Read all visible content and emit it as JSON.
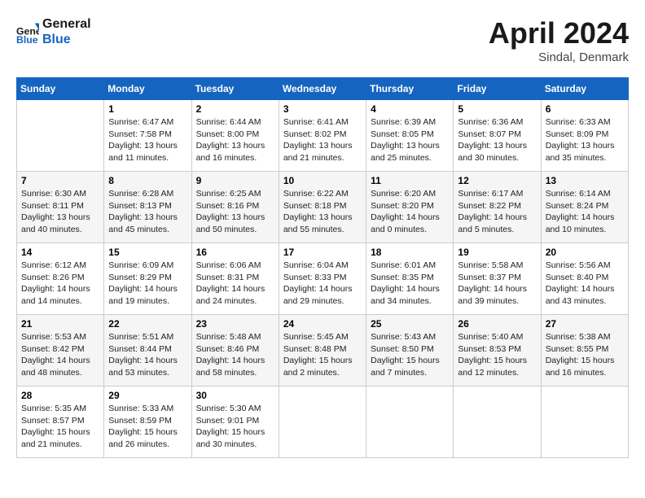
{
  "header": {
    "logo_line1": "General",
    "logo_line2": "Blue",
    "month": "April 2024",
    "location": "Sindal, Denmark"
  },
  "weekdays": [
    "Sunday",
    "Monday",
    "Tuesday",
    "Wednesday",
    "Thursday",
    "Friday",
    "Saturday"
  ],
  "weeks": [
    [
      {
        "day": "",
        "sunrise": "",
        "sunset": "",
        "daylight": ""
      },
      {
        "day": "1",
        "sunrise": "Sunrise: 6:47 AM",
        "sunset": "Sunset: 7:58 PM",
        "daylight": "Daylight: 13 hours and 11 minutes."
      },
      {
        "day": "2",
        "sunrise": "Sunrise: 6:44 AM",
        "sunset": "Sunset: 8:00 PM",
        "daylight": "Daylight: 13 hours and 16 minutes."
      },
      {
        "day": "3",
        "sunrise": "Sunrise: 6:41 AM",
        "sunset": "Sunset: 8:02 PM",
        "daylight": "Daylight: 13 hours and 21 minutes."
      },
      {
        "day": "4",
        "sunrise": "Sunrise: 6:39 AM",
        "sunset": "Sunset: 8:05 PM",
        "daylight": "Daylight: 13 hours and 25 minutes."
      },
      {
        "day": "5",
        "sunrise": "Sunrise: 6:36 AM",
        "sunset": "Sunset: 8:07 PM",
        "daylight": "Daylight: 13 hours and 30 minutes."
      },
      {
        "day": "6",
        "sunrise": "Sunrise: 6:33 AM",
        "sunset": "Sunset: 8:09 PM",
        "daylight": "Daylight: 13 hours and 35 minutes."
      }
    ],
    [
      {
        "day": "7",
        "sunrise": "Sunrise: 6:30 AM",
        "sunset": "Sunset: 8:11 PM",
        "daylight": "Daylight: 13 hours and 40 minutes."
      },
      {
        "day": "8",
        "sunrise": "Sunrise: 6:28 AM",
        "sunset": "Sunset: 8:13 PM",
        "daylight": "Daylight: 13 hours and 45 minutes."
      },
      {
        "day": "9",
        "sunrise": "Sunrise: 6:25 AM",
        "sunset": "Sunset: 8:16 PM",
        "daylight": "Daylight: 13 hours and 50 minutes."
      },
      {
        "day": "10",
        "sunrise": "Sunrise: 6:22 AM",
        "sunset": "Sunset: 8:18 PM",
        "daylight": "Daylight: 13 hours and 55 minutes."
      },
      {
        "day": "11",
        "sunrise": "Sunrise: 6:20 AM",
        "sunset": "Sunset: 8:20 PM",
        "daylight": "Daylight: 14 hours and 0 minutes."
      },
      {
        "day": "12",
        "sunrise": "Sunrise: 6:17 AM",
        "sunset": "Sunset: 8:22 PM",
        "daylight": "Daylight: 14 hours and 5 minutes."
      },
      {
        "day": "13",
        "sunrise": "Sunrise: 6:14 AM",
        "sunset": "Sunset: 8:24 PM",
        "daylight": "Daylight: 14 hours and 10 minutes."
      }
    ],
    [
      {
        "day": "14",
        "sunrise": "Sunrise: 6:12 AM",
        "sunset": "Sunset: 8:26 PM",
        "daylight": "Daylight: 14 hours and 14 minutes."
      },
      {
        "day": "15",
        "sunrise": "Sunrise: 6:09 AM",
        "sunset": "Sunset: 8:29 PM",
        "daylight": "Daylight: 14 hours and 19 minutes."
      },
      {
        "day": "16",
        "sunrise": "Sunrise: 6:06 AM",
        "sunset": "Sunset: 8:31 PM",
        "daylight": "Daylight: 14 hours and 24 minutes."
      },
      {
        "day": "17",
        "sunrise": "Sunrise: 6:04 AM",
        "sunset": "Sunset: 8:33 PM",
        "daylight": "Daylight: 14 hours and 29 minutes."
      },
      {
        "day": "18",
        "sunrise": "Sunrise: 6:01 AM",
        "sunset": "Sunset: 8:35 PM",
        "daylight": "Daylight: 14 hours and 34 minutes."
      },
      {
        "day": "19",
        "sunrise": "Sunrise: 5:58 AM",
        "sunset": "Sunset: 8:37 PM",
        "daylight": "Daylight: 14 hours and 39 minutes."
      },
      {
        "day": "20",
        "sunrise": "Sunrise: 5:56 AM",
        "sunset": "Sunset: 8:40 PM",
        "daylight": "Daylight: 14 hours and 43 minutes."
      }
    ],
    [
      {
        "day": "21",
        "sunrise": "Sunrise: 5:53 AM",
        "sunset": "Sunset: 8:42 PM",
        "daylight": "Daylight: 14 hours and 48 minutes."
      },
      {
        "day": "22",
        "sunrise": "Sunrise: 5:51 AM",
        "sunset": "Sunset: 8:44 PM",
        "daylight": "Daylight: 14 hours and 53 minutes."
      },
      {
        "day": "23",
        "sunrise": "Sunrise: 5:48 AM",
        "sunset": "Sunset: 8:46 PM",
        "daylight": "Daylight: 14 hours and 58 minutes."
      },
      {
        "day": "24",
        "sunrise": "Sunrise: 5:45 AM",
        "sunset": "Sunset: 8:48 PM",
        "daylight": "Daylight: 15 hours and 2 minutes."
      },
      {
        "day": "25",
        "sunrise": "Sunrise: 5:43 AM",
        "sunset": "Sunset: 8:50 PM",
        "daylight": "Daylight: 15 hours and 7 minutes."
      },
      {
        "day": "26",
        "sunrise": "Sunrise: 5:40 AM",
        "sunset": "Sunset: 8:53 PM",
        "daylight": "Daylight: 15 hours and 12 minutes."
      },
      {
        "day": "27",
        "sunrise": "Sunrise: 5:38 AM",
        "sunset": "Sunset: 8:55 PM",
        "daylight": "Daylight: 15 hours and 16 minutes."
      }
    ],
    [
      {
        "day": "28",
        "sunrise": "Sunrise: 5:35 AM",
        "sunset": "Sunset: 8:57 PM",
        "daylight": "Daylight: 15 hours and 21 minutes."
      },
      {
        "day": "29",
        "sunrise": "Sunrise: 5:33 AM",
        "sunset": "Sunset: 8:59 PM",
        "daylight": "Daylight: 15 hours and 26 minutes."
      },
      {
        "day": "30",
        "sunrise": "Sunrise: 5:30 AM",
        "sunset": "Sunset: 9:01 PM",
        "daylight": "Daylight: 15 hours and 30 minutes."
      },
      {
        "day": "",
        "sunrise": "",
        "sunset": "",
        "daylight": ""
      },
      {
        "day": "",
        "sunrise": "",
        "sunset": "",
        "daylight": ""
      },
      {
        "day": "",
        "sunrise": "",
        "sunset": "",
        "daylight": ""
      },
      {
        "day": "",
        "sunrise": "",
        "sunset": "",
        "daylight": ""
      }
    ]
  ]
}
